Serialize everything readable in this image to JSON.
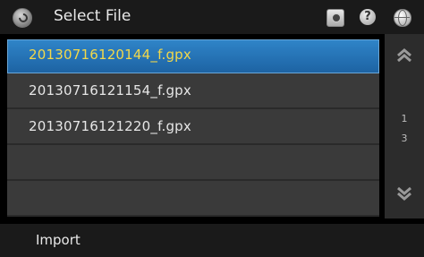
{
  "header": {
    "title": "Select File",
    "icons": [
      "back-icon",
      "camera-icon",
      "help-icon",
      "globe-icon"
    ],
    "help_glyph": "?"
  },
  "files": [
    {
      "name": "20130716120144_f.gpx",
      "selected": true
    },
    {
      "name": "20130716121154_f.gpx",
      "selected": false
    },
    {
      "name": "20130716121220_f.gpx",
      "selected": false
    },
    {
      "name": "",
      "selected": false
    },
    {
      "name": "",
      "selected": false
    }
  ],
  "pager": {
    "current": "1",
    "total": "3"
  },
  "footer": {
    "import_label": "Import"
  },
  "colors": {
    "selected_bg": "#1d63a3",
    "selected_text": "#f2d84a",
    "row_bg": "#3a3a3a"
  }
}
